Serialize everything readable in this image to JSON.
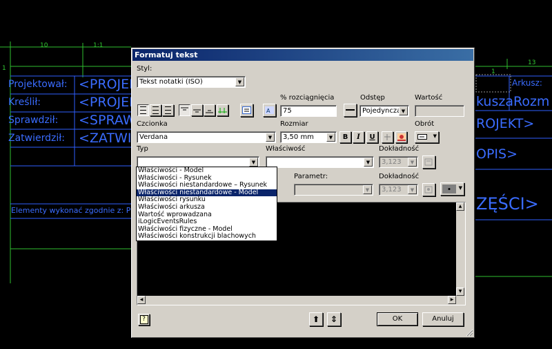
{
  "cad": {
    "labels": [
      "Projektował:",
      "Kreślił:",
      "Sprawdził:",
      "Zatwierdził:"
    ],
    "fields_left": [
      "<PROJEK",
      "<PROJEK",
      "<SPRAW",
      "<ZATWI"
    ],
    "note": "Elementy wykonać zgodnie z: PN-",
    "right_arkusz": "Arkusz:",
    "right_texts": [
      "kuszaRozm",
      "ROJEKT>",
      "OPIS>",
      "ZĘŚCI>"
    ],
    "dims": [
      "10",
      "1:1",
      "13",
      "1",
      "1"
    ]
  },
  "dialog": {
    "title": "Formatuj tekst",
    "styl_label": "Styl:",
    "styl_value": "Tekst notatki (ISO)",
    "rozciagniecie_label": "% rozciągnięcia",
    "rozciagniecie_value": "75",
    "odstep_label": "Odstęp",
    "odstep_value": "Pojedyncza",
    "wartosc_label": "Wartość",
    "czcionka_label": "Czcionka",
    "czcionka_value": "Verdana",
    "rozmiar_label": "Rozmiar",
    "rozmiar_value": "3,50 mm",
    "obrot_label": "Obrót",
    "typ_label": "Typ",
    "wlasciwosc_label": "Właściwość",
    "dokladnosc_label": "Dokładność",
    "dokladnosc_value": "3,123",
    "parametr_label": "Parametr:",
    "dokladnosc2_label": "Dokładność",
    "dokladnosc2_value": "3,123",
    "ok_label": "OK",
    "cancel_label": "Anuluj",
    "bold_label": "B",
    "italic_label": "I",
    "underline_label": "U",
    "help_label": "?"
  },
  "typ_options": [
    "Właściwości - Model",
    "Właściwości - Rysunek",
    "Właściwości niestandardowe – Rysunek",
    "Właściwości niestandardowe - Model",
    "Właściwości rysunku",
    "Właściwości arkusza",
    "Wartość wprowadzana",
    "iLogicEventsRules",
    "Właściwości fizyczne - Model",
    "Właściwości konstrukcji blachowych"
  ],
  "typ_selected_index": 3,
  "colors": {
    "titlebar": "#0a246a",
    "cad_blue": "#3a6cff",
    "cad_green": "#33cc33",
    "dialog": "#d4d0c8"
  }
}
